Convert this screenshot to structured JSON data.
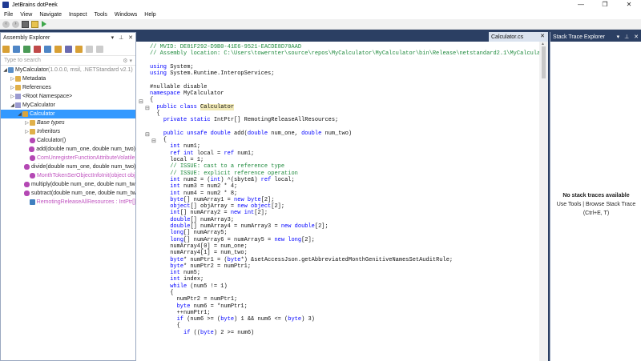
{
  "window": {
    "title": "JetBrains dotPeek",
    "controls": [
      "—",
      "❐",
      "✕"
    ]
  },
  "menu": [
    "File",
    "View",
    "Navigate",
    "Inspect",
    "Tools",
    "Windows",
    "Help"
  ],
  "assembly_explorer": {
    "title": "Assembly Explorer",
    "header_icons": [
      "▾",
      "⊥",
      "✕"
    ],
    "search_placeholder": "Type to search",
    "tree": [
      {
        "label": "MyCalculator",
        "suffix": " (1.0.0.0, msil, .NETStandard v2.1)",
        "level": 0,
        "arrow": "◢",
        "icon": "asm"
      },
      {
        "label": "Metadata",
        "level": 1,
        "arrow": "▷",
        "icon": "folder"
      },
      {
        "label": "References",
        "level": 1,
        "arrow": "▷",
        "icon": "folder"
      },
      {
        "label": "<Root Namespace>",
        "level": 1,
        "arrow": "▷",
        "icon": "ns"
      },
      {
        "label": "MyCalculator",
        "level": 1,
        "arrow": "◢",
        "icon": "ns"
      },
      {
        "label": "Calculator",
        "level": 2,
        "arrow": "◢",
        "icon": "cls",
        "selected": true
      },
      {
        "label": "Base types",
        "level": 3,
        "arrow": "▷",
        "icon": "folder",
        "italic": true
      },
      {
        "label": "Inheritors",
        "level": 3,
        "arrow": "▷",
        "icon": "folder",
        "italic": true
      },
      {
        "label": "Calculator()",
        "level": 3,
        "arrow": "",
        "icon": "mth"
      },
      {
        "label": "add(double num_one, double num_two)",
        "level": 3,
        "arrow": "",
        "icon": "mth"
      },
      {
        "label": "ComUnregisterFunctionAttributeVolatile",
        "level": 3,
        "arrow": "",
        "icon": "mth",
        "pink": true
      },
      {
        "label": "divide(double num_one, double num_two)",
        "level": 3,
        "arrow": "",
        "icon": "mth"
      },
      {
        "label": "MonthTokenSerObjectInfoInit(object obj",
        "level": 3,
        "arrow": "",
        "icon": "mth",
        "pink": true
      },
      {
        "label": "multiply(double num_one, double num_two)",
        "level": 3,
        "arrow": "",
        "icon": "mth"
      },
      {
        "label": "subtract(double num_one, double num_two)",
        "level": 3,
        "arrow": "",
        "icon": "mth"
      },
      {
        "label": "RemotingReleaseAllResources : IntPtr[]",
        "level": 3,
        "arrow": "",
        "icon": "fld",
        "pink": true
      }
    ]
  },
  "editor": {
    "tab_label": "Calculator.cs",
    "tab_close": "✕"
  },
  "stack_trace": {
    "title": "Stack Trace Explorer",
    "header_icons": [
      "▾",
      "⊥",
      "✕"
    ],
    "message_title": "No stack traces available",
    "message_line1": "Use Tools | Browse Stack Trace",
    "message_line2": "(Ctrl+E, T)"
  },
  "colors": {
    "background": "#2b3f63",
    "selection": "#3399ff",
    "keyword": "#0000ff",
    "comment": "#1f8a3d",
    "highlight": "#f2eab8",
    "pink_member": "#c055c0"
  }
}
